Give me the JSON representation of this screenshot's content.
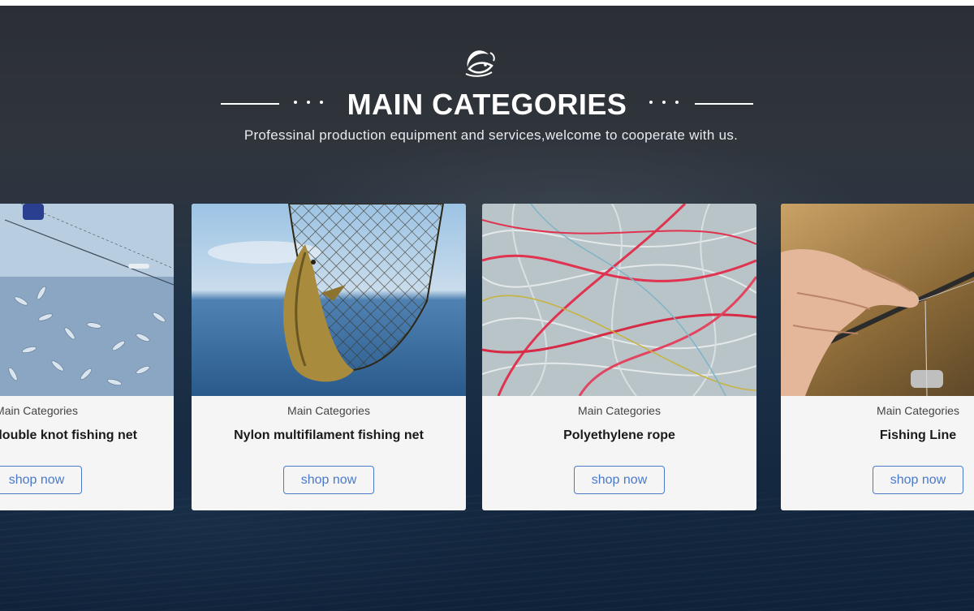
{
  "section": {
    "title": "MAIN CATEGORIES",
    "subtitle": "Professinal production equipment and services,welcome to cooperate with us.",
    "logo_icon": "fish-icon"
  },
  "colors": {
    "background_top": "#2b2f35",
    "background_bottom": "#0f223a",
    "button_accent": "#4a79c9",
    "card_background": "#f5f5f5"
  },
  "cards": [
    {
      "category": "Main Categories",
      "name": "Knotless double knot fishing net",
      "button": "shop now",
      "image": "fish-catch-in-net"
    },
    {
      "category": "Main Categories",
      "name": "Nylon multifilament fishing net",
      "button": "shop now",
      "image": "landing-net-with-fish"
    },
    {
      "category": "Main Categories",
      "name": "Polyethylene rope",
      "button": "shop now",
      "image": "tangled-colored-rope"
    },
    {
      "category": "Main Categories",
      "name": "Fishing Line",
      "button": "shop now",
      "image": "hand-holding-fishing-rod"
    }
  ]
}
